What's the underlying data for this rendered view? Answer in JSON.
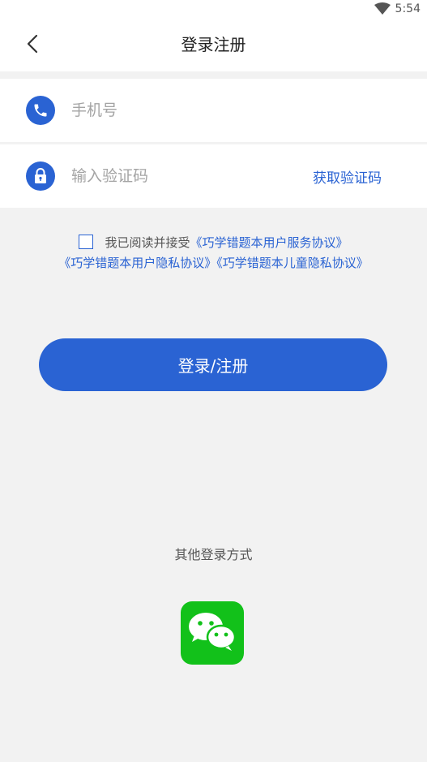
{
  "status_bar": {
    "time": "5:54",
    "wifi_icon": "wifi-icon"
  },
  "header": {
    "title": "登录注册",
    "back_icon": "back-icon"
  },
  "phone_field": {
    "icon": "phone-icon",
    "placeholder": "手机号",
    "value": ""
  },
  "code_field": {
    "icon": "lock-icon",
    "placeholder": "输入验证码",
    "value": "",
    "get_code_label": "获取验证码"
  },
  "agreement": {
    "checked": false,
    "prefix": "我已阅读并接受",
    "links": [
      "《巧学错题本用户服务协议》",
      "《巧学错题本用户隐私协议》",
      "《巧学错题本儿童隐私协议》"
    ]
  },
  "login_button": {
    "label": "登录/注册"
  },
  "other_login": {
    "title": "其他登录方式",
    "wechat_icon": "wechat-icon"
  },
  "colors": {
    "accent": "#2a63d3",
    "background": "#f2f2f2",
    "wechat": "#12c11a"
  }
}
